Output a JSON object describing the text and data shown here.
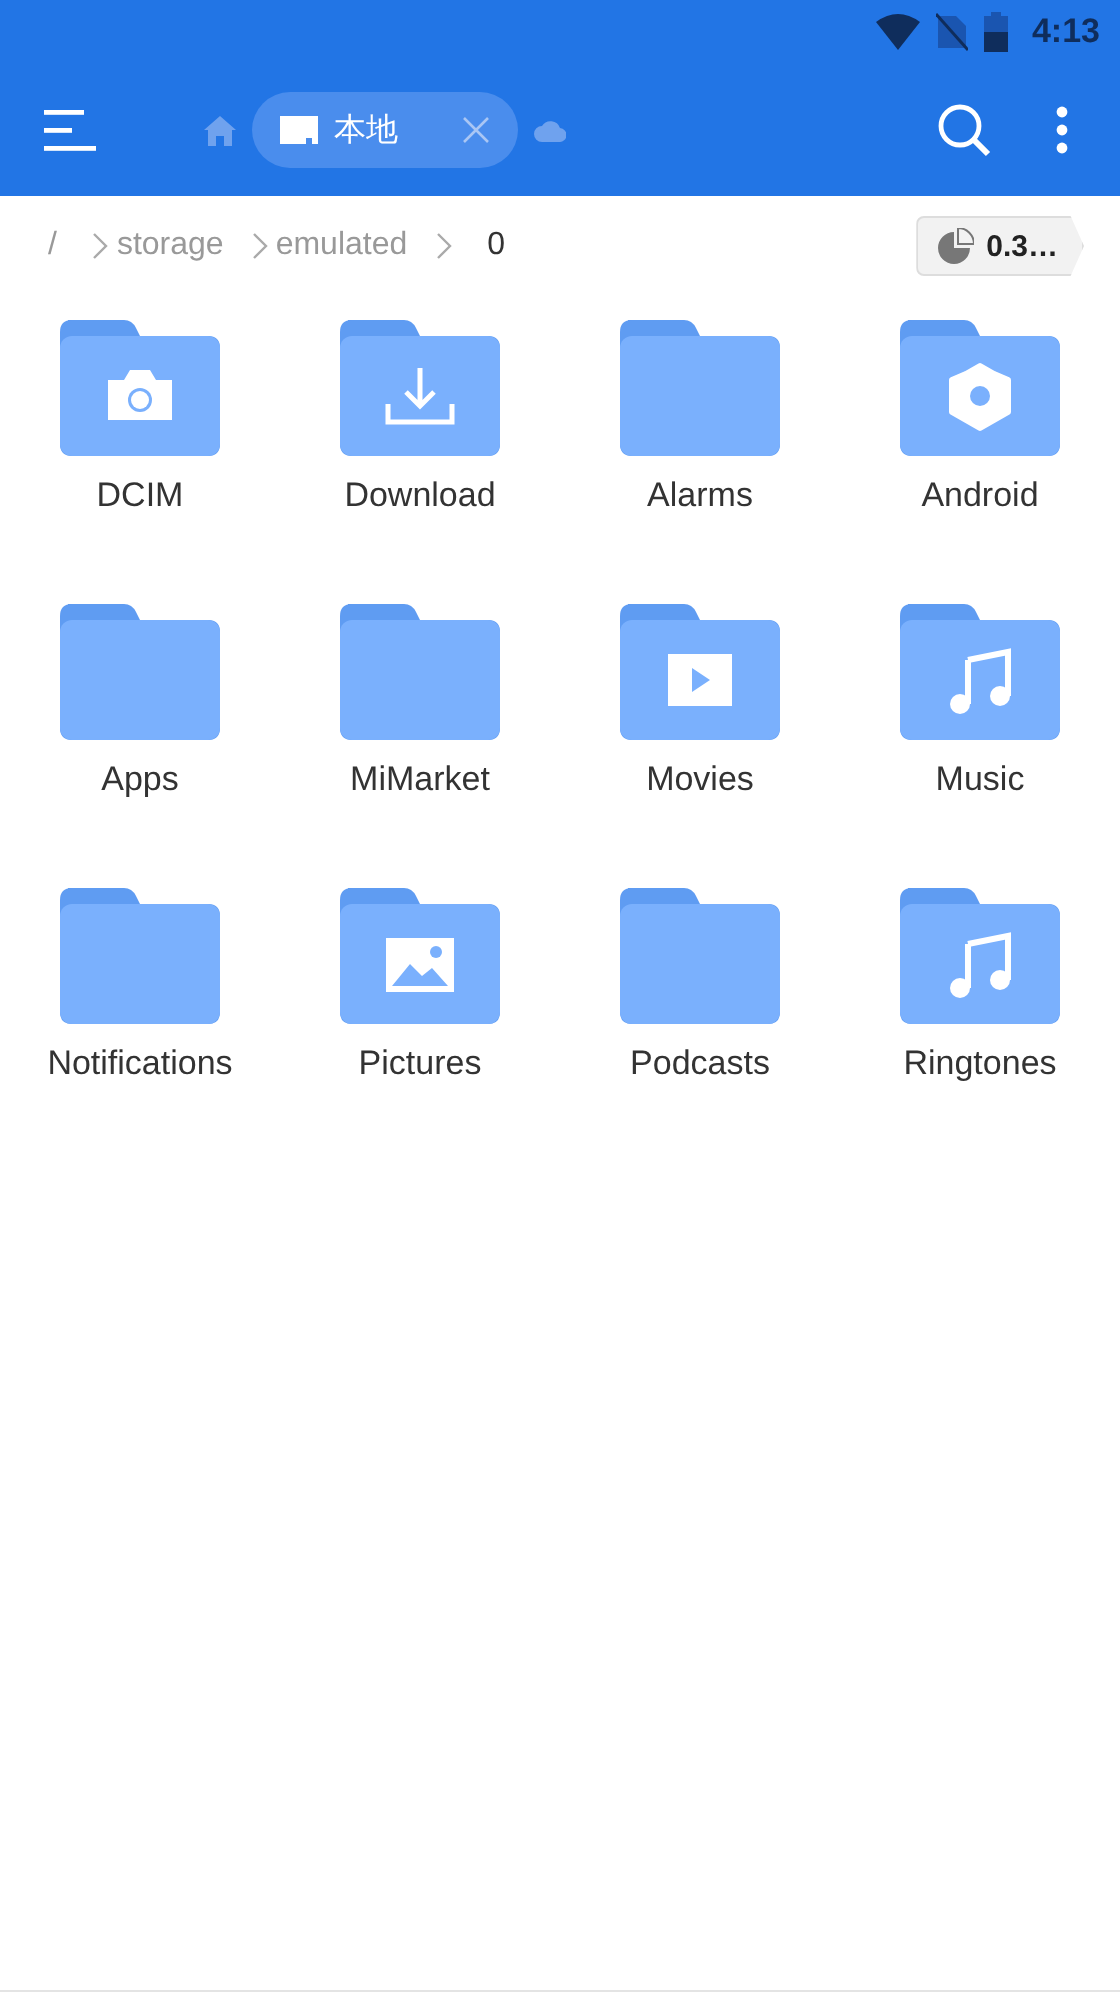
{
  "status_bar": {
    "time": "4:13"
  },
  "toolbar": {
    "tab": {
      "label": "本地",
      "selected": true
    }
  },
  "breadcrumb": [
    {
      "label": "/",
      "selected": false
    },
    {
      "label": "storage",
      "selected": false
    },
    {
      "label": "emulated",
      "selected": false
    },
    {
      "label": "0",
      "selected": true
    }
  ],
  "storage_chip": {
    "label": "0.3…"
  },
  "folders": [
    {
      "name": "DCIM",
      "kind": "camera"
    },
    {
      "name": "Download",
      "kind": "download"
    },
    {
      "name": "Alarms",
      "kind": "plain"
    },
    {
      "name": "Android",
      "kind": "gear"
    },
    {
      "name": "Apps",
      "kind": "plain"
    },
    {
      "name": "MiMarket",
      "kind": "plain"
    },
    {
      "name": "Movies",
      "kind": "play"
    },
    {
      "name": "Music",
      "kind": "music"
    },
    {
      "name": "Notifications",
      "kind": "plain"
    },
    {
      "name": "Pictures",
      "kind": "image"
    },
    {
      "name": "Podcasts",
      "kind": "plain"
    },
    {
      "name": "Ringtones",
      "kind": "music"
    }
  ]
}
